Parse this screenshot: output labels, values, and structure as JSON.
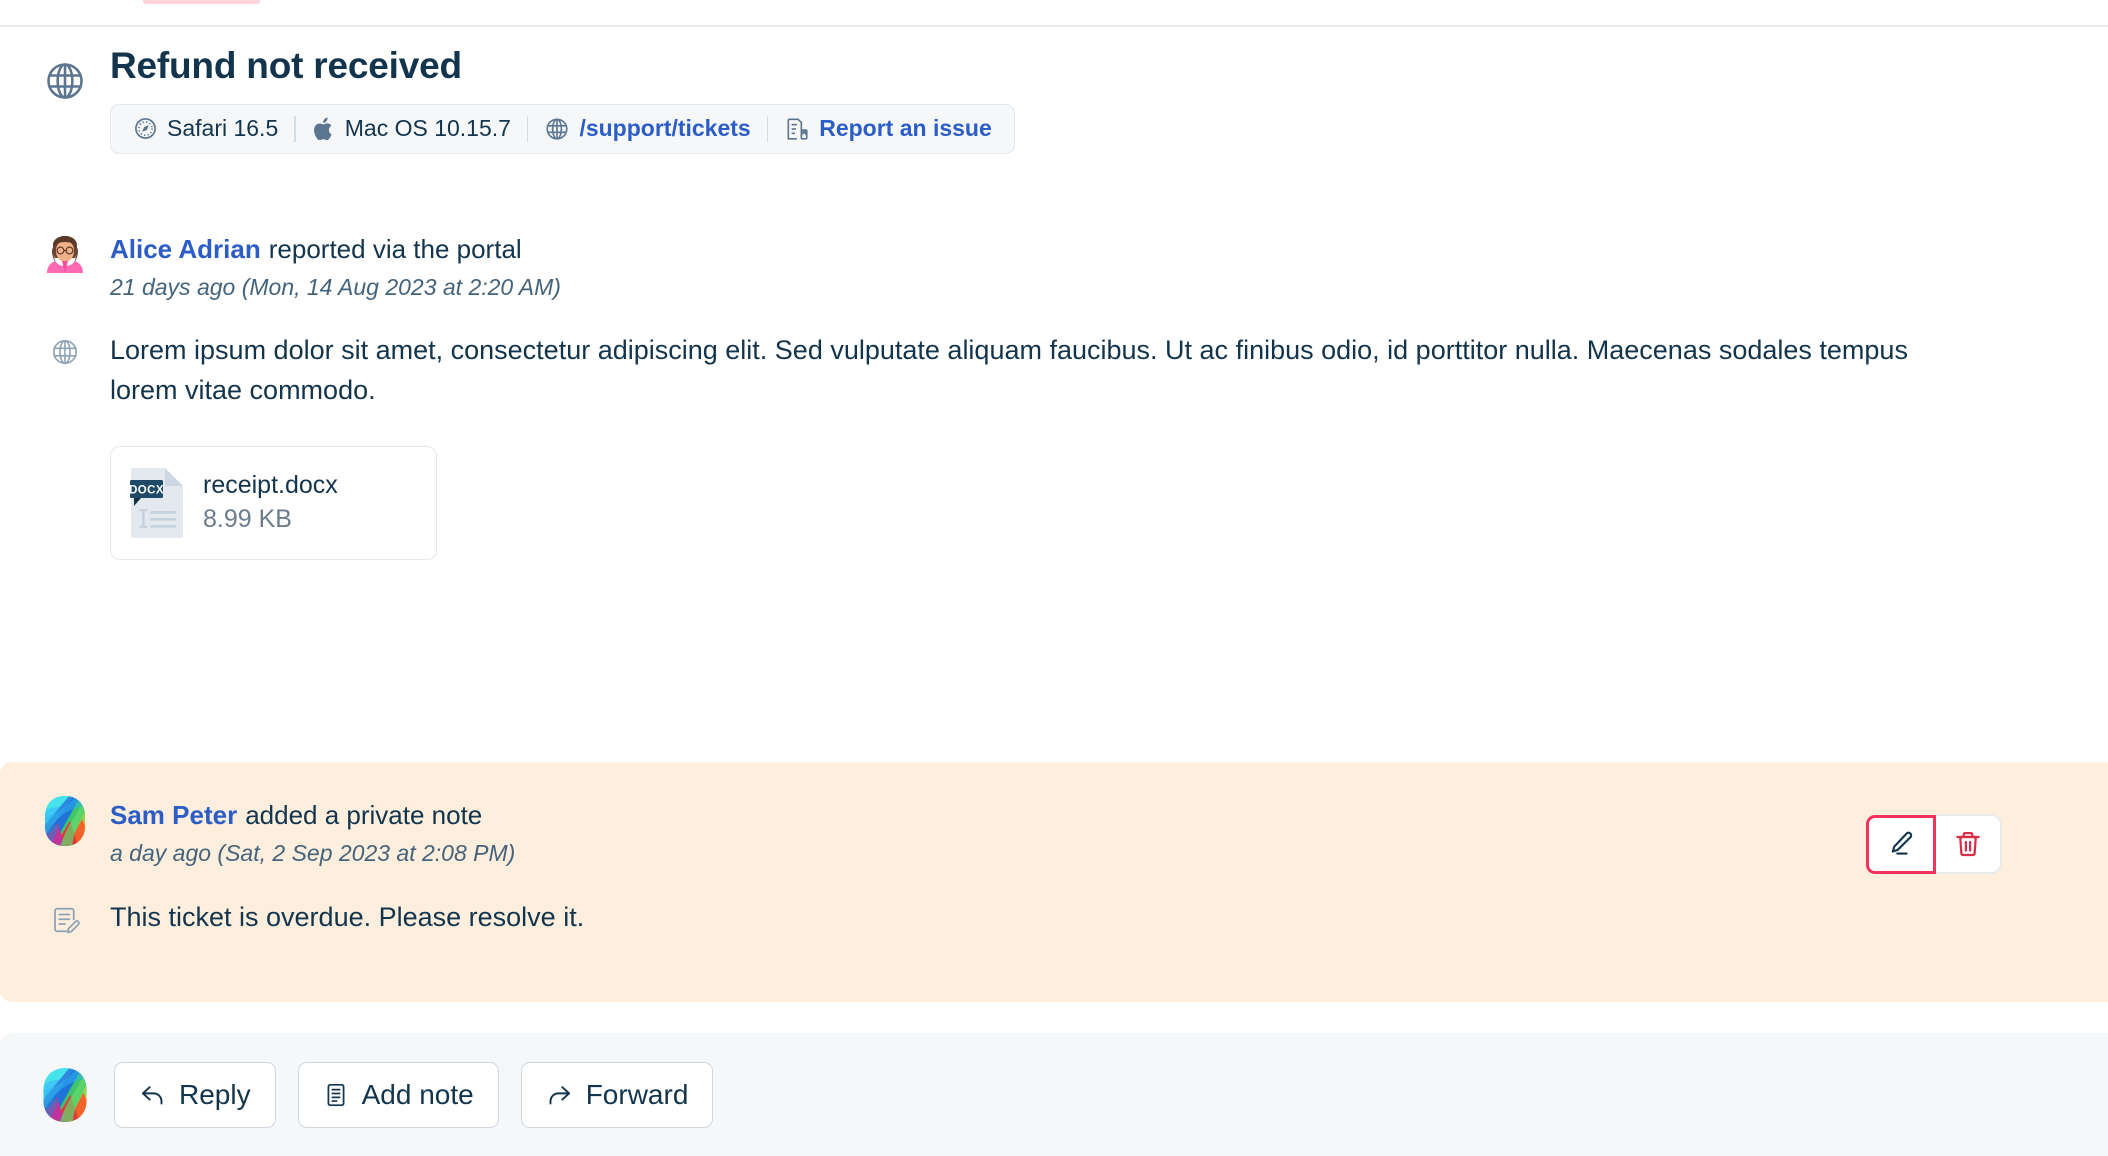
{
  "ticket": {
    "title": "Refund not received",
    "channel_icon": "globe-icon",
    "meta": [
      {
        "icon": "safari-icon",
        "label": "Safari 16.5",
        "link": false
      },
      {
        "icon": "apple-icon",
        "label": "Mac OS 10.15.7",
        "link": false
      },
      {
        "icon": "globe-icon",
        "label": "/support/tickets",
        "link": true
      },
      {
        "icon": "report-icon",
        "label": "Report an issue",
        "link": true
      }
    ]
  },
  "messages": [
    {
      "avatar": "woman-emoji-avatar",
      "author": "Alice Adrian",
      "action": "reported via the portal",
      "timestamp": "21 days ago (Mon, 14 Aug 2023 at 2:20 AM)",
      "source_icon": "globe-icon",
      "body": "Lorem ipsum dolor sit amet, consectetur adipiscing elit. Sed vulputate aliquam faucibus. Ut ac finibus odio, id porttitor nulla. Maecenas sodales tempus lorem vitae commodo.",
      "attachment": {
        "type_label": "DOCX",
        "name": "receipt.docx",
        "size": "8.99 KB"
      }
    },
    {
      "avatar": "freshworks-logo-avatar",
      "author": "Sam Peter",
      "action": "added a private note",
      "timestamp": "a day ago (Sat, 2 Sep 2023 at 2:08 PM)",
      "source_icon": "note-edit-icon",
      "body": "This ticket is overdue. Please resolve it.",
      "actions": [
        {
          "icon": "pencil-icon",
          "name": "edit-note-button",
          "highlighted": true
        },
        {
          "icon": "trash-icon",
          "name": "delete-note-button",
          "highlighted": false
        }
      ]
    }
  ],
  "action_bar": {
    "avatar": "freshworks-logo-avatar",
    "buttons": [
      {
        "icon": "reply-arrow-icon",
        "label": "Reply"
      },
      {
        "icon": "note-doc-icon",
        "label": "Add note"
      },
      {
        "icon": "forward-arrow-icon",
        "label": "Forward"
      }
    ]
  },
  "colors": {
    "link": "#2c5cc5",
    "text": "#12344d",
    "muted": "#6b7c8d",
    "note_bg": "#fdeedd",
    "bar_bg": "#f5f7f9",
    "danger": "#d72d47",
    "focus_outline": "#f5325c",
    "strip": "#fdd3da"
  }
}
